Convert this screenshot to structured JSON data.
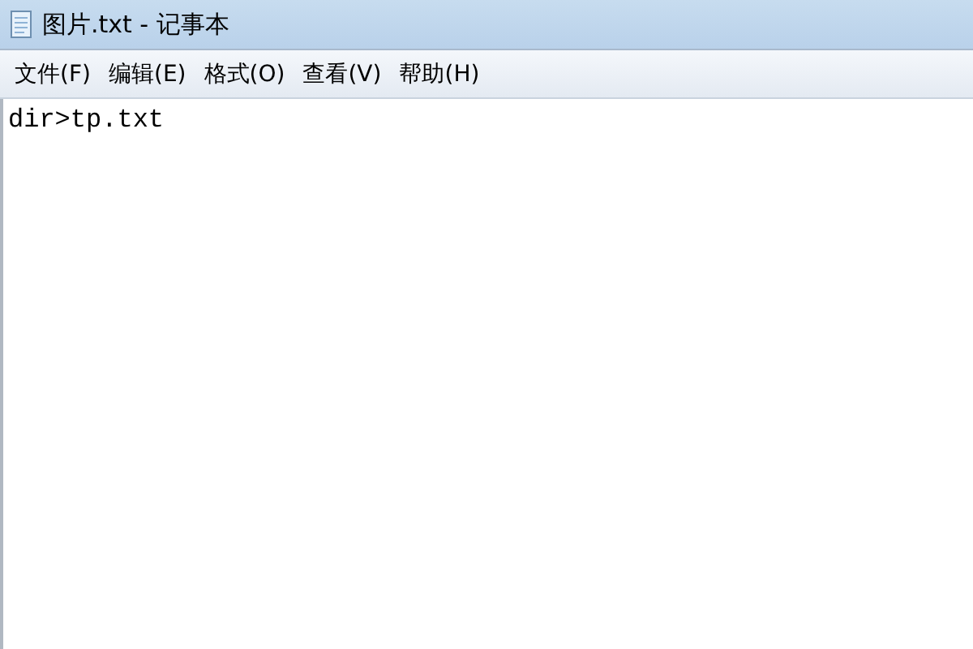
{
  "window": {
    "title": "图片.txt - 记事本"
  },
  "menu": [
    {
      "label": "文件(F)"
    },
    {
      "label": "编辑(E)"
    },
    {
      "label": "格式(O)"
    },
    {
      "label": "查看(V)"
    },
    {
      "label": "帮助(H)"
    }
  ],
  "editor": {
    "value": "dir>tp.txt"
  }
}
